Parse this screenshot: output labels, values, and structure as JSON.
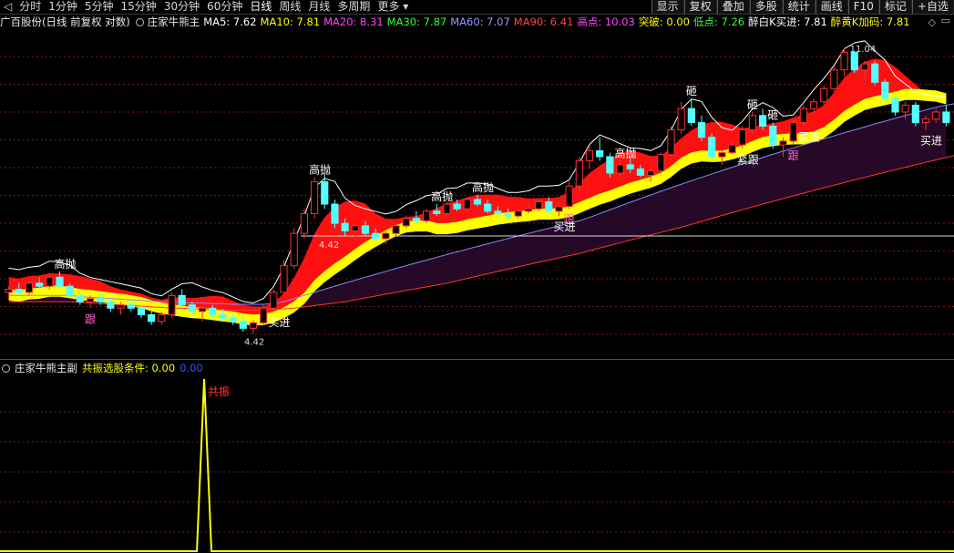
{
  "toolbar": {
    "back_icon": "back-arrow-icon",
    "periods": [
      "分时",
      "1分钟",
      "5分钟",
      "15分钟",
      "30分钟",
      "60分钟",
      "日线",
      "周线",
      "月线",
      "多周期",
      "更多"
    ],
    "active_period": "日线",
    "right_buttons": [
      "显示",
      "复权",
      "叠加",
      "多股",
      "统计",
      "画线",
      "F10",
      "标记",
      "+自选"
    ]
  },
  "main_panel": {
    "title": "广百股份(日线 前复权 对数)",
    "indicator": "庄家牛熊主",
    "readouts": [
      {
        "label": "MA5: 7.62",
        "color": "#ffffff"
      },
      {
        "label": "MA10: 7.81",
        "color": "#ffff00"
      },
      {
        "label": "MA20: 8.31",
        "color": "#ff44ff"
      },
      {
        "label": "MA30: 7.87",
        "color": "#33ff33"
      },
      {
        "label": "MA60: 7.07",
        "color": "#9999ff"
      },
      {
        "label": "MA90: 6.41",
        "color": "#ff4444"
      },
      {
        "label": "高点: 10.03",
        "color": "#ff44ff"
      },
      {
        "label": "突破: 0.00",
        "color": "#ffff00"
      },
      {
        "label": "低点: 7.26",
        "color": "#33ff33"
      },
      {
        "label": "醉白K买进: 7.81",
        "color": "#ffffff"
      },
      {
        "label": "醉黄K加码: 7.81",
        "color": "#ffff00"
      }
    ],
    "price_labels": {
      "high": "11.04",
      "low": "4.42",
      "low_line": "4.42"
    },
    "annotations": [
      {
        "text": "高抛",
        "color": "#ffffff",
        "i": 5
      },
      {
        "text": "高抛",
        "color": "#ffffff",
        "i": 30
      },
      {
        "text": "高抛",
        "color": "#ffffff",
        "i": 42
      },
      {
        "text": "高抛",
        "color": "#ffffff",
        "i": 46
      },
      {
        "text": "高抛",
        "color": "#ffffff",
        "i": 60
      },
      {
        "text": "砸",
        "color": "#ffffff",
        "i": 67
      },
      {
        "text": "砸",
        "color": "#ffffff",
        "i": 73
      },
      {
        "text": "砸",
        "color": "#ffffff",
        "i": 75
      },
      {
        "text": "跟",
        "color": "#ff66cc",
        "i": 8
      },
      {
        "text": "跟",
        "color": "#ff66cc",
        "i": 55
      },
      {
        "text": "跟",
        "color": "#ff66cc",
        "i": 77
      },
      {
        "text": "买进",
        "color": "#ffffff",
        "i": 26
      },
      {
        "text": "买进",
        "color": "#ffffff",
        "i": 54
      },
      {
        "text": "买进",
        "color": "#ffffff",
        "i": 78
      },
      {
        "text": "买进",
        "color": "#ffffff",
        "i": 90
      },
      {
        "text": "紧跟",
        "color": "#ffffff",
        "i": 72
      }
    ]
  },
  "sub_panel": {
    "indicator": "庄家牛熊主副",
    "readouts": [
      {
        "label": "共振选股条件: 0.00",
        "color": "#ffff00"
      },
      {
        "label": "0.00",
        "color": "#3355ff"
      }
    ],
    "signal_label": "共振",
    "signal_index": 19
  },
  "chart_data": {
    "type": "candlestick",
    "scale": "log",
    "ylim": [
      4.2,
      11.4
    ],
    "candles": [
      {
        "o": 5.05,
        "h": 5.15,
        "l": 4.95,
        "c": 5.1
      },
      {
        "o": 5.1,
        "h": 5.2,
        "l": 5.0,
        "c": 5.05
      },
      {
        "o": 5.05,
        "h": 5.25,
        "l": 5.0,
        "c": 5.2
      },
      {
        "o": 5.2,
        "h": 5.3,
        "l": 5.1,
        "c": 5.15
      },
      {
        "o": 5.15,
        "h": 5.35,
        "l": 5.1,
        "c": 5.3
      },
      {
        "o": 5.3,
        "h": 5.4,
        "l": 5.1,
        "c": 5.15
      },
      {
        "o": 5.15,
        "h": 5.2,
        "l": 4.95,
        "c": 5.0
      },
      {
        "o": 5.0,
        "h": 5.05,
        "l": 4.85,
        "c": 4.9
      },
      {
        "o": 4.9,
        "h": 5.0,
        "l": 4.8,
        "c": 4.95
      },
      {
        "o": 4.95,
        "h": 5.05,
        "l": 4.85,
        "c": 4.9
      },
      {
        "o": 4.9,
        "h": 4.95,
        "l": 4.75,
        "c": 4.8
      },
      {
        "o": 4.8,
        "h": 4.9,
        "l": 4.7,
        "c": 4.85
      },
      {
        "o": 4.85,
        "h": 4.95,
        "l": 4.75,
        "c": 4.8
      },
      {
        "o": 4.8,
        "h": 4.85,
        "l": 4.65,
        "c": 4.7
      },
      {
        "o": 4.7,
        "h": 4.8,
        "l": 4.55,
        "c": 4.6
      },
      {
        "o": 4.6,
        "h": 4.75,
        "l": 4.55,
        "c": 4.7
      },
      {
        "o": 4.7,
        "h": 5.05,
        "l": 4.65,
        "c": 5.0
      },
      {
        "o": 5.0,
        "h": 5.1,
        "l": 4.8,
        "c": 4.85
      },
      {
        "o": 4.85,
        "h": 4.9,
        "l": 4.7,
        "c": 4.75
      },
      {
        "o": 4.75,
        "h": 4.85,
        "l": 4.6,
        "c": 4.8
      },
      {
        "o": 4.8,
        "h": 4.85,
        "l": 4.65,
        "c": 4.7
      },
      {
        "o": 4.7,
        "h": 4.78,
        "l": 4.6,
        "c": 4.65
      },
      {
        "o": 4.65,
        "h": 4.72,
        "l": 4.55,
        "c": 4.6
      },
      {
        "o": 4.6,
        "h": 4.7,
        "l": 4.45,
        "c": 4.5
      },
      {
        "o": 4.5,
        "h": 4.62,
        "l": 4.42,
        "c": 4.58
      },
      {
        "o": 4.58,
        "h": 4.85,
        "l": 4.55,
        "c": 4.8
      },
      {
        "o": 4.8,
        "h": 5.1,
        "l": 4.75,
        "c": 5.05
      },
      {
        "o": 5.05,
        "h": 5.6,
        "l": 5.0,
        "c": 5.5
      },
      {
        "o": 5.5,
        "h": 6.2,
        "l": 5.45,
        "c": 6.1
      },
      {
        "o": 6.1,
        "h": 6.6,
        "l": 6.0,
        "c": 6.5
      },
      {
        "o": 6.5,
        "h": 7.3,
        "l": 6.4,
        "c": 7.2
      },
      {
        "o": 7.2,
        "h": 7.4,
        "l": 6.6,
        "c": 6.7
      },
      {
        "o": 6.7,
        "h": 6.8,
        "l": 6.2,
        "c": 6.3
      },
      {
        "o": 6.3,
        "h": 6.4,
        "l": 6.05,
        "c": 6.15
      },
      {
        "o": 6.15,
        "h": 6.3,
        "l": 6.0,
        "c": 6.25
      },
      {
        "o": 6.25,
        "h": 6.35,
        "l": 6.05,
        "c": 6.1
      },
      {
        "o": 6.1,
        "h": 6.2,
        "l": 5.95,
        "c": 6.0
      },
      {
        "o": 6.0,
        "h": 6.15,
        "l": 5.9,
        "c": 6.1
      },
      {
        "o": 6.1,
        "h": 6.3,
        "l": 6.05,
        "c": 6.25
      },
      {
        "o": 6.25,
        "h": 6.45,
        "l": 6.2,
        "c": 6.4
      },
      {
        "o": 6.4,
        "h": 6.55,
        "l": 6.3,
        "c": 6.35
      },
      {
        "o": 6.35,
        "h": 6.6,
        "l": 6.3,
        "c": 6.55
      },
      {
        "o": 6.55,
        "h": 6.7,
        "l": 6.45,
        "c": 6.5
      },
      {
        "o": 6.5,
        "h": 6.75,
        "l": 6.45,
        "c": 6.7
      },
      {
        "o": 6.7,
        "h": 6.8,
        "l": 6.55,
        "c": 6.6
      },
      {
        "o": 6.6,
        "h": 6.85,
        "l": 6.55,
        "c": 6.8
      },
      {
        "o": 6.8,
        "h": 6.9,
        "l": 6.65,
        "c": 6.7
      },
      {
        "o": 6.7,
        "h": 6.8,
        "l": 6.5,
        "c": 6.55
      },
      {
        "o": 6.55,
        "h": 6.65,
        "l": 6.4,
        "c": 6.5
      },
      {
        "o": 6.5,
        "h": 6.6,
        "l": 6.35,
        "c": 6.45
      },
      {
        "o": 6.45,
        "h": 6.6,
        "l": 6.4,
        "c": 6.55
      },
      {
        "o": 6.55,
        "h": 6.7,
        "l": 6.5,
        "c": 6.6
      },
      {
        "o": 6.6,
        "h": 6.8,
        "l": 6.55,
        "c": 6.75
      },
      {
        "o": 6.75,
        "h": 6.85,
        "l": 6.5,
        "c": 6.55
      },
      {
        "o": 6.55,
        "h": 6.7,
        "l": 6.45,
        "c": 6.65
      },
      {
        "o": 6.65,
        "h": 7.2,
        "l": 6.6,
        "c": 7.1
      },
      {
        "o": 7.1,
        "h": 7.8,
        "l": 7.0,
        "c": 7.7
      },
      {
        "o": 7.7,
        "h": 8.1,
        "l": 7.5,
        "c": 7.95
      },
      {
        "o": 7.95,
        "h": 8.3,
        "l": 7.7,
        "c": 7.8
      },
      {
        "o": 7.8,
        "h": 7.9,
        "l": 7.3,
        "c": 7.4
      },
      {
        "o": 7.4,
        "h": 7.7,
        "l": 7.3,
        "c": 7.6
      },
      {
        "o": 7.6,
        "h": 7.8,
        "l": 7.4,
        "c": 7.5
      },
      {
        "o": 7.5,
        "h": 7.6,
        "l": 7.3,
        "c": 7.35
      },
      {
        "o": 7.35,
        "h": 7.5,
        "l": 7.2,
        "c": 7.45
      },
      {
        "o": 7.45,
        "h": 7.9,
        "l": 7.4,
        "c": 7.85
      },
      {
        "o": 7.85,
        "h": 8.6,
        "l": 7.8,
        "c": 8.5
      },
      {
        "o": 8.5,
        "h": 9.3,
        "l": 8.4,
        "c": 9.1
      },
      {
        "o": 9.1,
        "h": 9.4,
        "l": 8.6,
        "c": 8.7
      },
      {
        "o": 8.7,
        "h": 8.9,
        "l": 8.2,
        "c": 8.3
      },
      {
        "o": 8.3,
        "h": 8.4,
        "l": 7.7,
        "c": 7.8
      },
      {
        "o": 7.8,
        "h": 8.0,
        "l": 7.6,
        "c": 7.9
      },
      {
        "o": 7.9,
        "h": 8.2,
        "l": 7.85,
        "c": 8.1
      },
      {
        "o": 8.1,
        "h": 8.6,
        "l": 8.0,
        "c": 8.5
      },
      {
        "o": 8.5,
        "h": 9.0,
        "l": 8.4,
        "c": 8.9
      },
      {
        "o": 8.9,
        "h": 9.1,
        "l": 8.5,
        "c": 8.6
      },
      {
        "o": 8.6,
        "h": 8.7,
        "l": 8.0,
        "c": 8.1
      },
      {
        "o": 8.1,
        "h": 8.3,
        "l": 7.8,
        "c": 8.2
      },
      {
        "o": 8.2,
        "h": 8.8,
        "l": 8.1,
        "c": 8.7
      },
      {
        "o": 8.7,
        "h": 9.2,
        "l": 8.6,
        "c": 9.1
      },
      {
        "o": 9.1,
        "h": 9.4,
        "l": 8.9,
        "c": 9.3
      },
      {
        "o": 9.3,
        "h": 9.8,
        "l": 9.2,
        "c": 9.7
      },
      {
        "o": 9.7,
        "h": 10.4,
        "l": 9.6,
        "c": 10.3
      },
      {
        "o": 10.3,
        "h": 11.04,
        "l": 10.1,
        "c": 10.9
      },
      {
        "o": 10.9,
        "h": 10.95,
        "l": 10.2,
        "c": 10.3
      },
      {
        "o": 10.3,
        "h": 10.6,
        "l": 10.0,
        "c": 10.5
      },
      {
        "o": 10.5,
        "h": 10.6,
        "l": 9.8,
        "c": 9.9
      },
      {
        "o": 9.9,
        "h": 10.0,
        "l": 9.3,
        "c": 9.4
      },
      {
        "o": 9.4,
        "h": 9.5,
        "l": 8.9,
        "c": 9.0
      },
      {
        "o": 9.0,
        "h": 9.3,
        "l": 8.8,
        "c": 9.2
      },
      {
        "o": 9.2,
        "h": 9.3,
        "l": 8.6,
        "c": 8.7
      },
      {
        "o": 8.7,
        "h": 8.9,
        "l": 8.5,
        "c": 8.8
      },
      {
        "o": 8.8,
        "h": 9.1,
        "l": 8.7,
        "c": 9.0
      },
      {
        "o": 9.0,
        "h": 9.2,
        "l": 8.6,
        "c": 8.7
      }
    ],
    "series": [
      {
        "name": "MA60",
        "color": "#8888ff",
        "values": [
          5.0,
          5.0,
          5.0,
          5.0,
          5.0,
          5.0,
          5.0,
          4.98,
          4.97,
          4.96,
          4.95,
          4.94,
          4.93,
          4.92,
          4.91,
          4.9,
          4.9,
          4.89,
          4.88,
          4.88,
          4.87,
          4.87,
          4.86,
          4.86,
          4.86,
          4.86,
          4.87,
          4.9,
          4.95,
          5.0,
          5.05,
          5.1,
          5.15,
          5.2,
          5.25,
          5.3,
          5.35,
          5.4,
          5.45,
          5.5,
          5.55,
          5.6,
          5.65,
          5.7,
          5.75,
          5.8,
          5.85,
          5.9,
          5.95,
          6.0,
          6.05,
          6.1,
          6.15,
          6.2,
          6.25,
          6.3,
          6.35,
          6.42,
          6.5,
          6.58,
          6.66,
          6.74,
          6.82,
          6.9,
          6.98,
          7.06,
          7.14,
          7.22,
          7.3,
          7.38,
          7.46,
          7.54,
          7.62,
          7.7,
          7.78,
          7.86,
          7.94,
          8.02,
          8.1,
          8.18,
          8.26,
          8.34,
          8.42,
          8.5,
          8.58,
          8.66,
          8.74,
          8.82,
          8.9,
          8.98,
          9.06,
          9.14,
          9.2,
          9.25,
          9.3,
          9.35
        ]
      },
      {
        "name": "MA90",
        "color": "#ff3333",
        "values": [
          4.9,
          4.9,
          4.9,
          4.9,
          4.9,
          4.9,
          4.9,
          4.89,
          4.88,
          4.87,
          4.86,
          4.85,
          4.84,
          4.83,
          4.82,
          4.81,
          4.8,
          4.8,
          4.79,
          4.79,
          4.78,
          4.78,
          4.77,
          4.77,
          4.77,
          4.77,
          4.78,
          4.79,
          4.8,
          4.82,
          4.84,
          4.86,
          4.88,
          4.9,
          4.93,
          4.96,
          4.99,
          5.02,
          5.05,
          5.08,
          5.11,
          5.14,
          5.17,
          5.2,
          5.24,
          5.28,
          5.32,
          5.36,
          5.4,
          5.44,
          5.48,
          5.52,
          5.56,
          5.6,
          5.64,
          5.68,
          5.72,
          5.77,
          5.82,
          5.87,
          5.92,
          5.97,
          6.02,
          6.07,
          6.12,
          6.17,
          6.22,
          6.28,
          6.34,
          6.4,
          6.46,
          6.52,
          6.58,
          6.64,
          6.7,
          6.76,
          6.82,
          6.88,
          6.94,
          7.0,
          7.06,
          7.12,
          7.18,
          7.24,
          7.3,
          7.36,
          7.42,
          7.48,
          7.54,
          7.6,
          7.66,
          7.72,
          7.78,
          7.84,
          7.9,
          7.96
        ]
      }
    ]
  },
  "sub_chart_data": {
    "type": "line",
    "series_name": "共振",
    "color": "#ffff00",
    "signal_index": 19,
    "ylim": [
      0,
      1
    ]
  }
}
